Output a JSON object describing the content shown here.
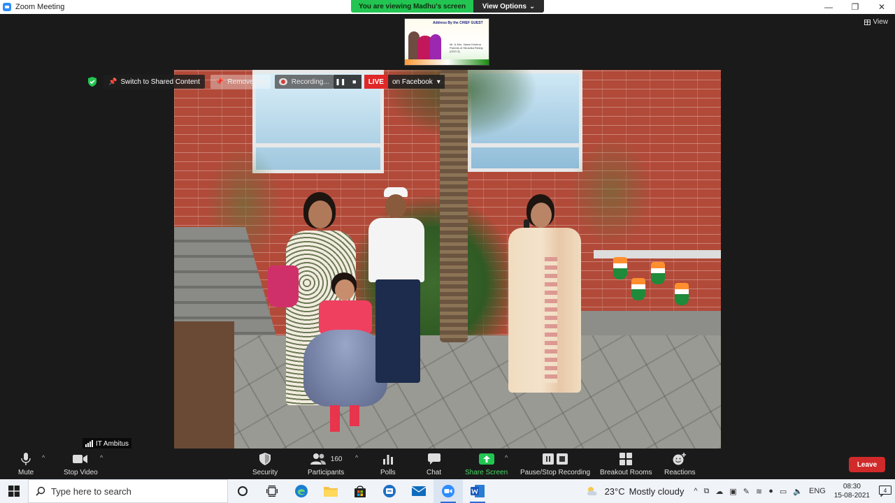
{
  "window": {
    "title": "Zoom Meeting",
    "minimize": "—",
    "restore": "❐",
    "close": "✕"
  },
  "banner": {
    "viewing": "You are viewing Madhu's screen",
    "view_options": "View Options"
  },
  "view_button": "View",
  "thumbnail": {
    "title": "Address By the CHIEF GUEST",
    "names": "Mr. & Mrs. Vamsi Krishna Parents of Shravika Reddy (CEO 3)"
  },
  "share_toolbar": {
    "switch_label": "Switch to Shared Content",
    "remove_pin_label": "Remove Pin",
    "recording_label": "Recording...",
    "live_label": "LIVE",
    "facebook_label": "on Facebook"
  },
  "participant_name": "IT Ambitus",
  "controls": {
    "mute": "Mute",
    "stop_video": "Stop Video",
    "security": "Security",
    "participants": "Participants",
    "participants_count": "160",
    "polls": "Polls",
    "chat": "Chat",
    "share_screen": "Share Screen",
    "pause_recording": "Pause/Stop Recording",
    "breakout_rooms": "Breakout Rooms",
    "reactions": "Reactions",
    "leave": "Leave"
  },
  "taskbar": {
    "search_placeholder": "Type here to search",
    "weather_temp": "23°C",
    "weather_text": "Mostly cloudy",
    "language": "ENG",
    "time": "08:30",
    "date": "15-08-2021",
    "notifications": "4"
  },
  "colors": {
    "accent_green": "#23c552",
    "live_red": "#e02828",
    "leave_red": "#d12a2a",
    "zoom_blue": "#2d8cff"
  }
}
